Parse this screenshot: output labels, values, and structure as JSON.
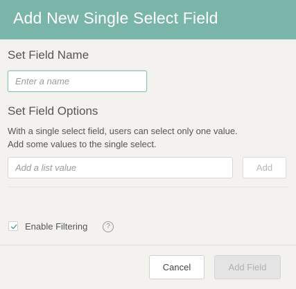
{
  "dialog": {
    "title": "Add New Single Select Field"
  },
  "name_section": {
    "title": "Set Field Name",
    "input_placeholder": "Enter a name",
    "input_value": ""
  },
  "options_section": {
    "title": "Set Field Options",
    "description_line1": "With a single select field, users can select only one value.",
    "description_line2": "Add some values to the single select.",
    "list_input_placeholder": "Add a list value",
    "list_input_value": "",
    "add_label": "Add"
  },
  "filtering": {
    "label": "Enable Filtering",
    "checked": true,
    "help_icon": "question-mark-icon",
    "help_glyph": "?"
  },
  "footer": {
    "cancel_label": "Cancel",
    "add_field_label": "Add Field"
  },
  "colors": {
    "header_bg": "#7ab5a9",
    "accent": "#5fa898",
    "background": "#f3f2ee"
  }
}
